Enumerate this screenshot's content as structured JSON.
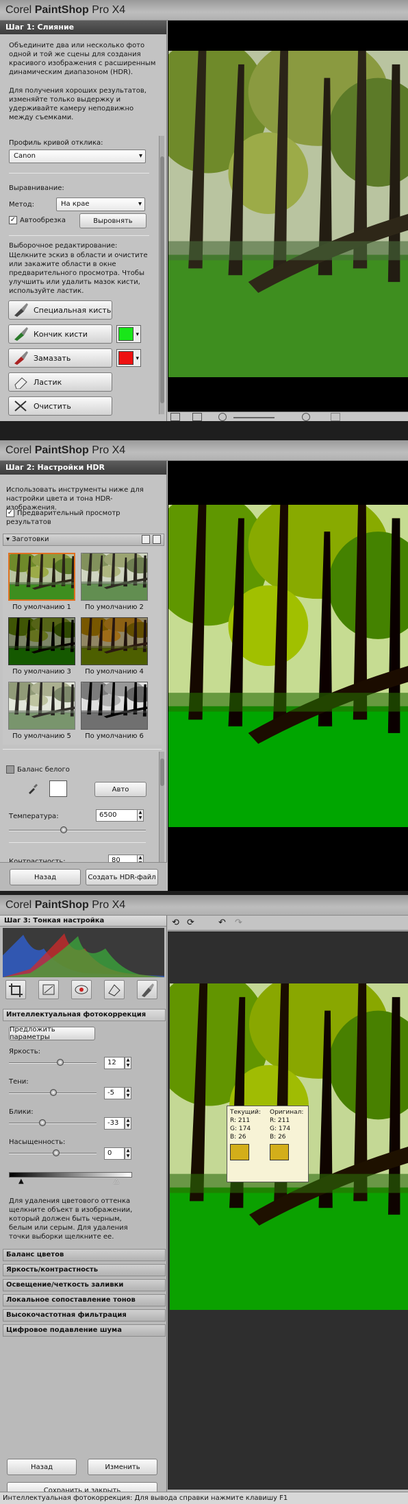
{
  "app": {
    "brand_light": "Corel",
    "brand_bold": "PaintShop",
    "brand_suffix": "Pro X4"
  },
  "step1": {
    "header": "Шаг 1: Слияние",
    "intro": "Объедините два или несколько фото одной и той же сцены для создания красивого изображения с расширенным динамическим диапазоном (HDR).",
    "tip": "Для получения хороших результатов, изменяйте только выдержку и удерживайте камеру неподвижно между съемками.",
    "curve_label": "Профиль кривой отклика:",
    "curve_value": "Canon",
    "align_label": "Выравнивание:",
    "method_label": "Метод:",
    "method_value": "На крае",
    "autocrop_label": "Автообрезка",
    "align_button": "Выровнять",
    "edit_label": "Выборочное редактирование:",
    "edit_help": "Щелкните эскиз в области и очистите или закажите области в окне предварительного просмотра. Чтобы улучшить или удалить мазок кисти, используйте ластик.",
    "tools": [
      "Специальная кисть",
      "Кончик кисти",
      "Замазать",
      "Ластик",
      "Очистить"
    ],
    "tip_color": "#19e619",
    "smear_color": "#ee1111"
  },
  "step2": {
    "header": "Шаг 2: Настройки HDR",
    "intro": "Использовать инструменты ниже для настройки цвета и тона HDR-изображения.",
    "preview_label": "Предварительный просмотр результатов",
    "presets_label": "Заготовки",
    "presets": [
      "По умолчанию 1",
      "По умолчанию 2",
      "По умолчанию 3",
      "По умолчанию 4",
      "По умолчанию 5",
      "По умолчанию 6"
    ],
    "wb_label": "Баланс белого",
    "auto_button": "Авто",
    "temp_label": "Температура:",
    "temp_value": "6500",
    "contrast_label": "Контрастность:",
    "contrast_value": "80",
    "back_button": "Назад",
    "create_button": "Создать HDR-файл"
  },
  "step3": {
    "header": "Шаг 3: Тонкая настройка",
    "section_title": "Интеллектуальная фотокоррекция",
    "suggest_button": "Предложить параметры",
    "brightness_label": "Яркость:",
    "brightness_value": "12",
    "shadows_label": "Тени:",
    "shadows_value": "-5",
    "highlights_label": "Блики:",
    "highlights_value": "-33",
    "saturation_label": "Насыщенность:",
    "saturation_value": "0",
    "help": "Для удаления цветового оттенка щелкните объект в изображении, который должен быть черным, белым или серым. Для удаления точки выборки щелкните ее.",
    "accordion": [
      "Баланс цветов",
      "Яркость/контрастность",
      "Освещение/четкость заливки",
      "Локальное сопоставление тонов",
      "Высокочастотная фильтрация",
      "Цифровое подавление шума"
    ],
    "back_button": "Назад",
    "change_button": "Изменить",
    "save_button": "Сохранить и закрыть",
    "status": "Интеллектуальная фотокоррекция: Для вывода справки нажмите клавишу F1",
    "tooltip": {
      "current_label": "Текущий:",
      "original_label": "Оригинал:",
      "cur_r": "R: 211",
      "cur_g": "G: 174",
      "cur_b": "B: 26",
      "orig_r": "R: 211",
      "orig_g": "G: 174",
      "orig_b": "B: 26",
      "swatch_color": "#d3ae1a"
    }
  }
}
